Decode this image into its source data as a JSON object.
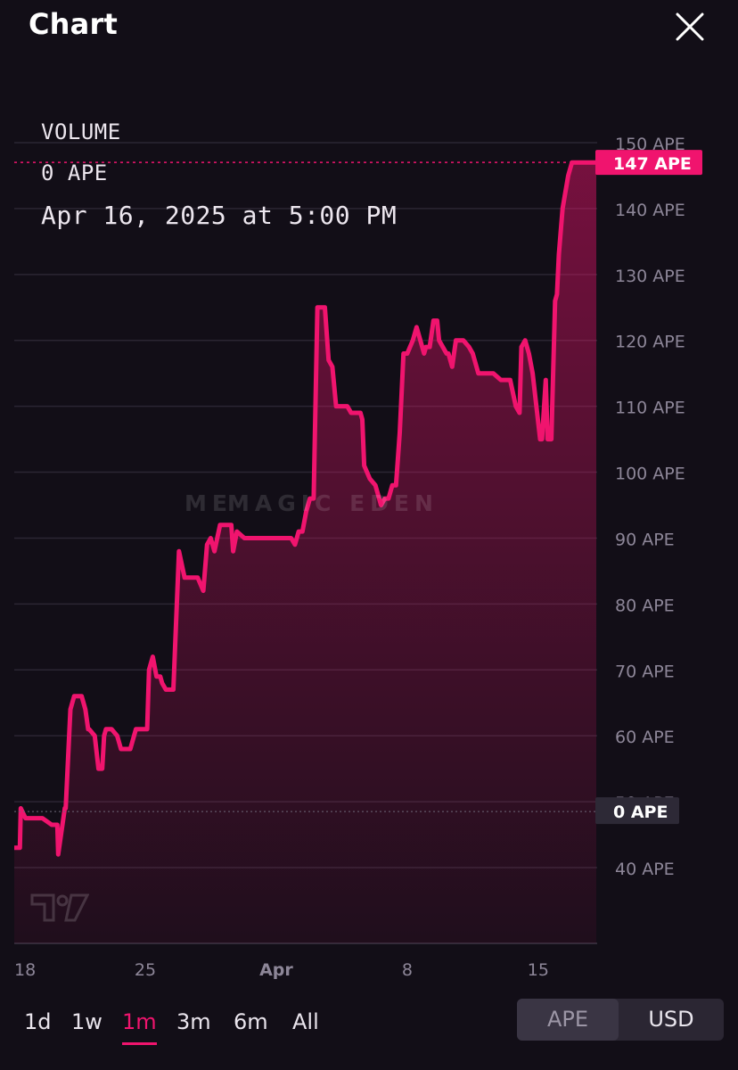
{
  "header": {
    "title": "Chart",
    "close_icon": "close-icon"
  },
  "overlay": {
    "label": "VOLUME",
    "value": "0 APE",
    "date": "Apr 16, 2025 at 5:00 PM"
  },
  "watermark": "MAGIC EDEN",
  "ranges": {
    "items": [
      "1d",
      "1w",
      "1m",
      "3m",
      "6m",
      "All"
    ],
    "active": "1m"
  },
  "currency": {
    "options": [
      "APE",
      "USD"
    ],
    "selected": "APE"
  },
  "colors": {
    "accent": "#f0146e",
    "background": "#120e17",
    "grid": "#2b2633"
  },
  "chart_data": {
    "type": "area",
    "y_unit": "APE",
    "yticks": [
      "40 APE",
      "50 APE",
      "60 APE",
      "70 APE",
      "80 APE",
      "90 APE",
      "100 APE",
      "110 APE",
      "120 APE",
      "130 APE",
      "140 APE",
      "150 APE"
    ],
    "ylim": [
      35,
      150
    ],
    "xticks": [
      {
        "label": "18",
        "x": 18
      },
      {
        "label": "25",
        "x": 25
      },
      {
        "label": "Apr",
        "x": 32
      },
      {
        "label": "8",
        "x": 39
      },
      {
        "label": "15",
        "x": 46
      }
    ],
    "xlim": [
      18,
      49.15
    ],
    "current_price": {
      "label": "147 APE",
      "value": 147
    },
    "volume_marker": {
      "label": "0 APE",
      "value": 48.5
    },
    "series": [
      {
        "x": [
          18,
          18.3,
          18.35,
          18.6,
          19.0,
          19.5,
          20.0,
          20.3,
          20.35,
          20.7,
          20.75,
          21.0,
          21.2,
          21.4,
          21.6,
          21.8,
          21.95,
          22.0,
          22.3,
          22.5,
          22.7,
          22.8,
          22.9,
          23.2,
          23.5,
          23.7,
          24.0,
          24.2,
          24.4,
          24.5,
          25.1,
          25.2,
          25.4,
          25.6,
          25.8,
          25.9,
          26.1,
          26.3,
          26.5,
          26.8,
          27.1,
          27.2,
          27.5,
          27.8,
          28.1,
          28.3,
          28.5,
          28.7,
          29.0,
          29.3,
          29.6,
          29.7,
          29.9,
          30.3,
          30.5,
          30.8,
          31.0,
          31.2,
          32.0,
          32.8,
          33.0,
          33.2,
          33.4,
          33.6,
          33.8,
          34.0,
          34.2,
          34.6,
          34.8,
          35.0,
          35.2,
          35.5,
          35.8,
          36.0,
          36.5,
          36.6,
          36.7,
          37.0,
          37.3,
          37.6,
          37.8,
          38.0,
          38.2,
          38.4,
          38.6,
          38.8,
          39.0,
          39.3,
          39.5,
          39.7,
          39.9,
          40.0,
          40.2,
          40.4,
          40.6,
          40.7,
          40.9,
          41.1,
          41.2,
          41.4,
          41.6,
          41.8,
          42.0,
          42.3,
          42.5,
          42.8,
          43.0,
          43.2,
          43.6,
          44.0,
          44.5,
          44.8,
          45.0,
          45.1,
          45.3,
          45.5,
          45.7,
          45.9,
          46.1,
          46.2,
          46.4,
          46.5,
          46.7,
          46.9,
          47.0,
          47.1,
          47.3,
          47.6,
          47.8,
          47.9,
          48.0,
          48.1,
          48.2,
          48.4,
          48.6,
          48.7,
          48.8,
          49.0,
          49.1
        ],
        "y": [
          43,
          43,
          49,
          47.5,
          47.5,
          47.5,
          46.5,
          46.5,
          42,
          49,
          49,
          64,
          66,
          66,
          66,
          64,
          61,
          61,
          60,
          55,
          55,
          60,
          61,
          61,
          60,
          58,
          58,
          58,
          60,
          61,
          61,
          70,
          72,
          69,
          69,
          68,
          67,
          67,
          67,
          88,
          84,
          84,
          84,
          84,
          82,
          89,
          90,
          88,
          92,
          92,
          92,
          88,
          91,
          90,
          90,
          90,
          90,
          90,
          90,
          90,
          89,
          91,
          91,
          94,
          96,
          96,
          125,
          125,
          117,
          116,
          110,
          110,
          110,
          109,
          109,
          108,
          101,
          99,
          98,
          95,
          96,
          96,
          98,
          98,
          106,
          118,
          118,
          120,
          122,
          120,
          118,
          119,
          119,
          123,
          123,
          120,
          119,
          118,
          118,
          116,
          120,
          120,
          120,
          119,
          118,
          115,
          115,
          115,
          115,
          114,
          114,
          110,
          109,
          119,
          120,
          118,
          115,
          110,
          105,
          105,
          114,
          105,
          105,
          126,
          127,
          133,
          140,
          145,
          147,
          147,
          147,
          147,
          147,
          147,
          147,
          147,
          147,
          147,
          147
        ]
      }
    ]
  }
}
